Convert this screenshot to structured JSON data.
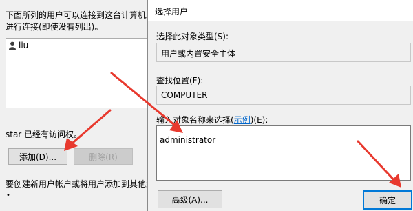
{
  "background_dialog": {
    "description_line1": "下面所列的用户可以连接到这台计算机。另",
    "description_line2": "进行连接(即使没有列出)。",
    "users": [
      {
        "name": "liu",
        "icon": "user-icon"
      }
    ],
    "access_note": "star 已经有访问权。",
    "add_label": "添加(D)...",
    "remove_label": "删除(R)",
    "bottom_note": "要创建新用户帐户或将用户添加到其他组，",
    "bullet": "•"
  },
  "select_user_dialog": {
    "title": "选择用户",
    "object_type_label": "选择此对象类型(S):",
    "object_type_value": "用户或内置安全主体",
    "location_label": "查找位置(F):",
    "location_value": "COMPUTER",
    "names_label_prefix": "输入对象名称来选择(",
    "names_label_link": "示例",
    "names_label_suffix": ")(E):",
    "names_value": "administrator",
    "advanced_label": "高级(A)...",
    "ok_label": "确定"
  },
  "colors": {
    "annotation_arrow": "#e8392e",
    "default_button_border": "#0078d7",
    "link": "#0066cc"
  }
}
